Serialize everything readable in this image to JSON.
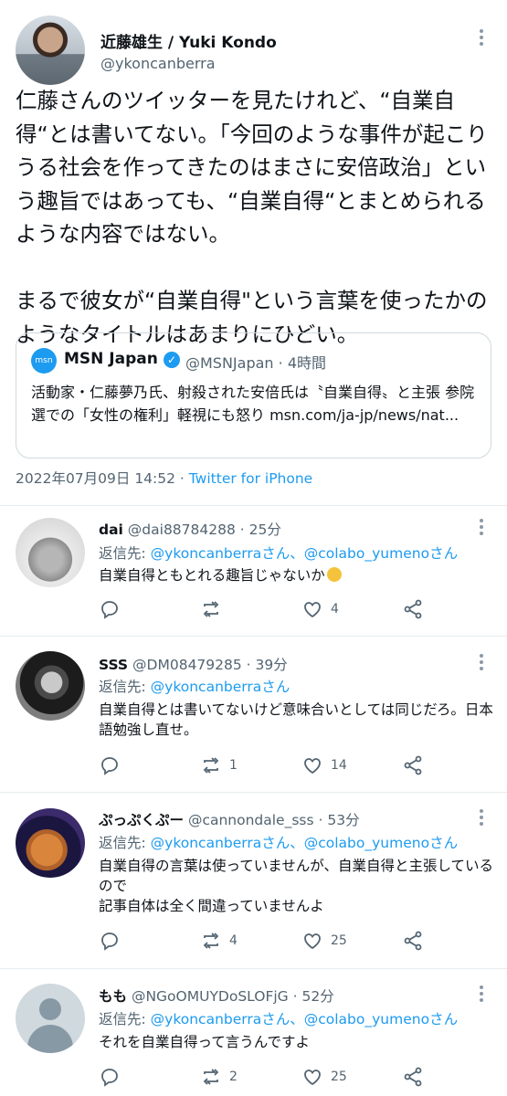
{
  "main_tweet": {
    "author_name": "近藤雄生 / Yuki Kondo",
    "author_handle": "@ykoncanberra",
    "text": "仁藤さんのツイッターを見たけれど、“自業自得“とは書いてない。「今回のような事件が起こりうる社会を作ってきたのはまさに安倍政治」という趣旨ではあっても、“自業自得“とまとめられるような内容ではない。\n\nまるで彼女が“自業自得\"という言葉を使ったかのようなタイトルはあまりにひどい。",
    "quoted": {
      "avatar_label": "msn",
      "author_name": "MSN Japan",
      "meta": "@MSNJapan · 4時間",
      "text": "活動家・仁藤夢乃氏、射殺された安倍氏は〝自業自得〟と主張 参院選での「女性の権利」軽視にも怒り msn.com/ja-jp/news/nat..."
    },
    "timestamp": "2022年07月09日 14:52 · ",
    "source": "Twitter for iPhone"
  },
  "replies": [
    {
      "name": "dai",
      "meta": " @dai88784288 · 25分",
      "reply_to_prefix": "返信先: ",
      "reply_to_users": "@ykoncanberraさん、@colabo_yumenoさん",
      "text": "自業自得ともとれる趣旨じゃないか",
      "retweets": "",
      "likes": "4"
    },
    {
      "name": "SSS",
      "meta": " @DM08479285 · 39分",
      "reply_to_prefix": "返信先: ",
      "reply_to_users": "@ykoncanberraさん",
      "text": "自業自得とは書いてないけど意味合いとしては同じだろ。日本語勉強し直せ。",
      "retweets": "1",
      "likes": "14"
    },
    {
      "name": "ぷっぷくぷー",
      "meta": " @cannondale_sss · 53分",
      "reply_to_prefix": "返信先: ",
      "reply_to_users": "@ykoncanberraさん、@colabo_yumenoさん",
      "text": "自業自得の言葉は使っていませんが、自業自得と主張しているので\n記事自体は全く間違っていませんよ",
      "retweets": "4",
      "likes": "25"
    },
    {
      "name": "もも",
      "meta": " @NGoOMUYDoSLOFjG · 52分",
      "reply_to_prefix": "返信先: ",
      "reply_to_users": "@ykoncanberraさん、@colabo_yumenoさん",
      "text": "それを自業自得って言うんですよ",
      "retweets": "2",
      "likes": "25"
    }
  ],
  "colors": {
    "link": "#1d9bf0",
    "secondary_text": "#536471",
    "primary_text": "#0f1419",
    "divider": "#e6ecf0"
  },
  "icons": [
    "reply-icon",
    "retweet-icon",
    "like-icon",
    "share-icon",
    "more-options-icon",
    "verified-badge-icon"
  ]
}
